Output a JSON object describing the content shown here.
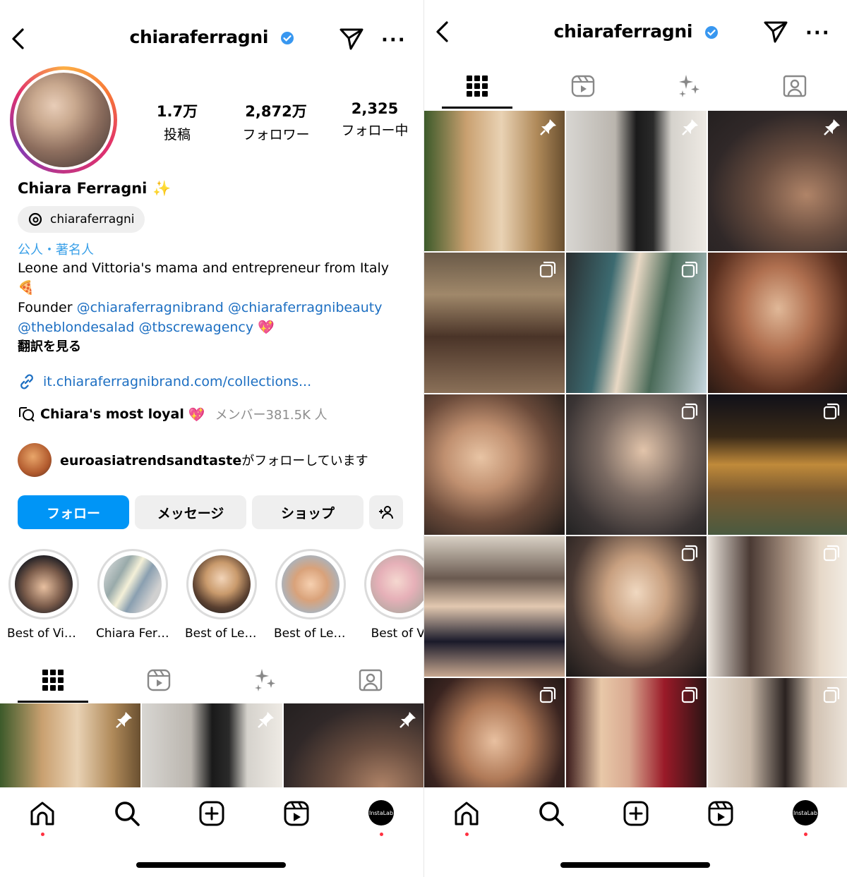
{
  "left": {
    "header": {
      "username": "chiaraferragni"
    },
    "stats": [
      {
        "value": "1.7万",
        "label": "投稿"
      },
      {
        "value": "2,872万",
        "label": "フォロワー"
      },
      {
        "value": "2,325",
        "label": "フォロー中"
      }
    ],
    "profile": {
      "display_name": "Chiara Ferragni",
      "threads_handle": "chiaraferragni",
      "category": "公人・著名人",
      "bio_line1": "Leone and Vittoria's mama and entrepreneur from Italy",
      "bio_emoji": "🍕",
      "bio_founder": "Founder",
      "bio_link1": "@chiaraferragnibrand",
      "bio_link2": "@chiaraferragnibeauty",
      "bio_link3": "@theblondesalad",
      "bio_link4": "@tbscrewagency",
      "bio_heart": "💖",
      "translate": "翻訳を見る",
      "url": "it.chiaraferragnibrand.com/collections...",
      "channel_name": "Chiara's most loyal",
      "channel_heart": "💖",
      "channel_members": "メンバー381.5K 人",
      "followed_by_user": "euroasiatrendsandtaste",
      "followed_by_suffix": "がフォローしています"
    },
    "buttons": {
      "follow": "フォロー",
      "message": "メッセージ",
      "shop": "ショップ"
    },
    "highlights": [
      {
        "label": "Best of Vitt..."
      },
      {
        "label": "Chiara Ferr..."
      },
      {
        "label": "Best of Leo..."
      },
      {
        "label": "Best of Leo..."
      },
      {
        "label": "Best of Vi"
      }
    ],
    "tabs": [
      "grid",
      "reels",
      "collabs",
      "tagged"
    ]
  },
  "right": {
    "header": {
      "username": "chiaraferragni"
    },
    "tabs": [
      "grid",
      "reels",
      "collabs",
      "tagged"
    ],
    "grid_count": 15
  },
  "bottom_nav": [
    "home",
    "search",
    "create",
    "reels",
    "profile"
  ],
  "profile_bubble": "InstaLab",
  "colors": {
    "accent": "#0095f6",
    "link": "#1d6fc2",
    "notification": "#ff3040",
    "verified": "#3897f0"
  }
}
